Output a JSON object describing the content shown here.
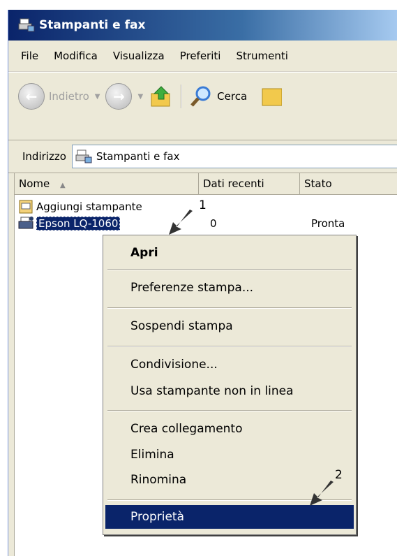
{
  "window": {
    "title": "Stampanti e fax"
  },
  "menubar": {
    "items": [
      "File",
      "Modifica",
      "Visualizza",
      "Preferiti",
      "Strumenti"
    ]
  },
  "toolbar": {
    "back_label": "Indietro",
    "search_label": "Cerca"
  },
  "address": {
    "label": "Indirizzo",
    "value": "Stampanti e fax"
  },
  "columns": {
    "name": "Nome",
    "recent": "Dati recenti",
    "status": "Stato"
  },
  "items": [
    {
      "name": "Aggiungi stampante",
      "recent": "",
      "status": ""
    },
    {
      "name": "Epson LQ-1060",
      "recent": "0",
      "status": "Pronta"
    }
  ],
  "context_menu": {
    "open": "Apri",
    "print_prefs": "Preferenze stampa...",
    "pause": "Sospendi stampa",
    "sharing": "Condivisione...",
    "offline": "Usa stampante non in linea",
    "shortcut": "Crea collegamento",
    "delete": "Elimina",
    "rename": "Rinomina",
    "properties": "Proprietà"
  },
  "annotations": {
    "step1": "1",
    "step2": "2"
  },
  "colors": {
    "selection": "#0a246a",
    "window_bg": "#ece9d8",
    "title_start": "#0a246a",
    "title_end": "#a6caf0"
  }
}
